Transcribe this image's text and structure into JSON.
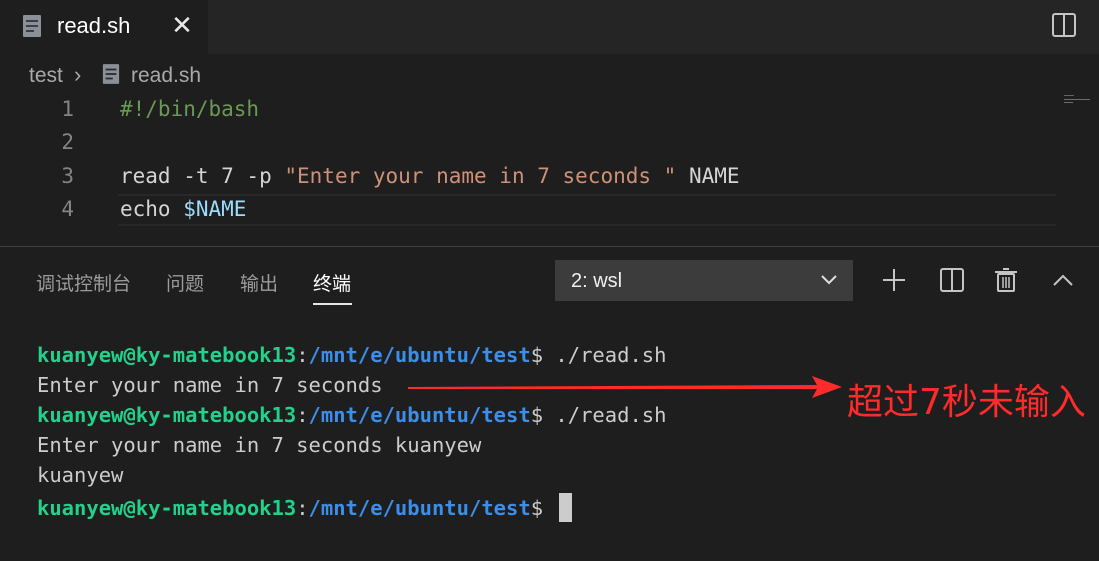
{
  "tabs": [
    {
      "label": "read.sh",
      "icon": "shell-file-icon",
      "active": true
    }
  ],
  "breadcrumb": {
    "folder": "test",
    "file": "read.sh"
  },
  "editor": {
    "lines": [
      {
        "number": "1",
        "tokens": [
          {
            "text": "#!/bin/bash",
            "kind": "comment"
          }
        ]
      },
      {
        "number": "2",
        "tokens": []
      },
      {
        "number": "3",
        "tokens": [
          {
            "text": "read -t 7 -p ",
            "kind": "plain"
          },
          {
            "text": "\"Enter your name in 7 seconds \"",
            "kind": "string"
          },
          {
            "text": " NAME",
            "kind": "plain"
          }
        ]
      },
      {
        "number": "4",
        "tokens": [
          {
            "text": "echo ",
            "kind": "plain"
          },
          {
            "text": "$NAME",
            "kind": "var"
          }
        ]
      }
    ]
  },
  "panel": {
    "tabs": [
      {
        "label": "调试控制台"
      },
      {
        "label": "问题"
      },
      {
        "label": "输出"
      },
      {
        "label": "终端",
        "active": true
      }
    ],
    "terminal_select": "2: wsl"
  },
  "terminal": {
    "user": "kuanyew@ky-matebook13",
    "path": "/mnt/e/ubuntu/test",
    "lines": [
      {
        "kind": "prompt",
        "cmd": " ./read.sh"
      },
      {
        "kind": "output",
        "text": "Enter your name in 7 seconds"
      },
      {
        "kind": "prompt",
        "cmd": " ./read.sh"
      },
      {
        "kind": "output",
        "text": "Enter your name in 7 seconds kuanyew"
      },
      {
        "kind": "output",
        "text": "kuanyew"
      },
      {
        "kind": "prompt",
        "cmd": " "
      }
    ]
  },
  "annotation": {
    "text": "超过7秒未输入",
    "color": "#ff2b2b"
  },
  "colors": {
    "editor_bg": "#1e1e1e",
    "tabbar_bg": "#252526",
    "comment": "#6a9955",
    "string": "#ce9178",
    "variable": "#9cdcfe",
    "term_user": "#23d18b",
    "term_path": "#3b8eea"
  }
}
